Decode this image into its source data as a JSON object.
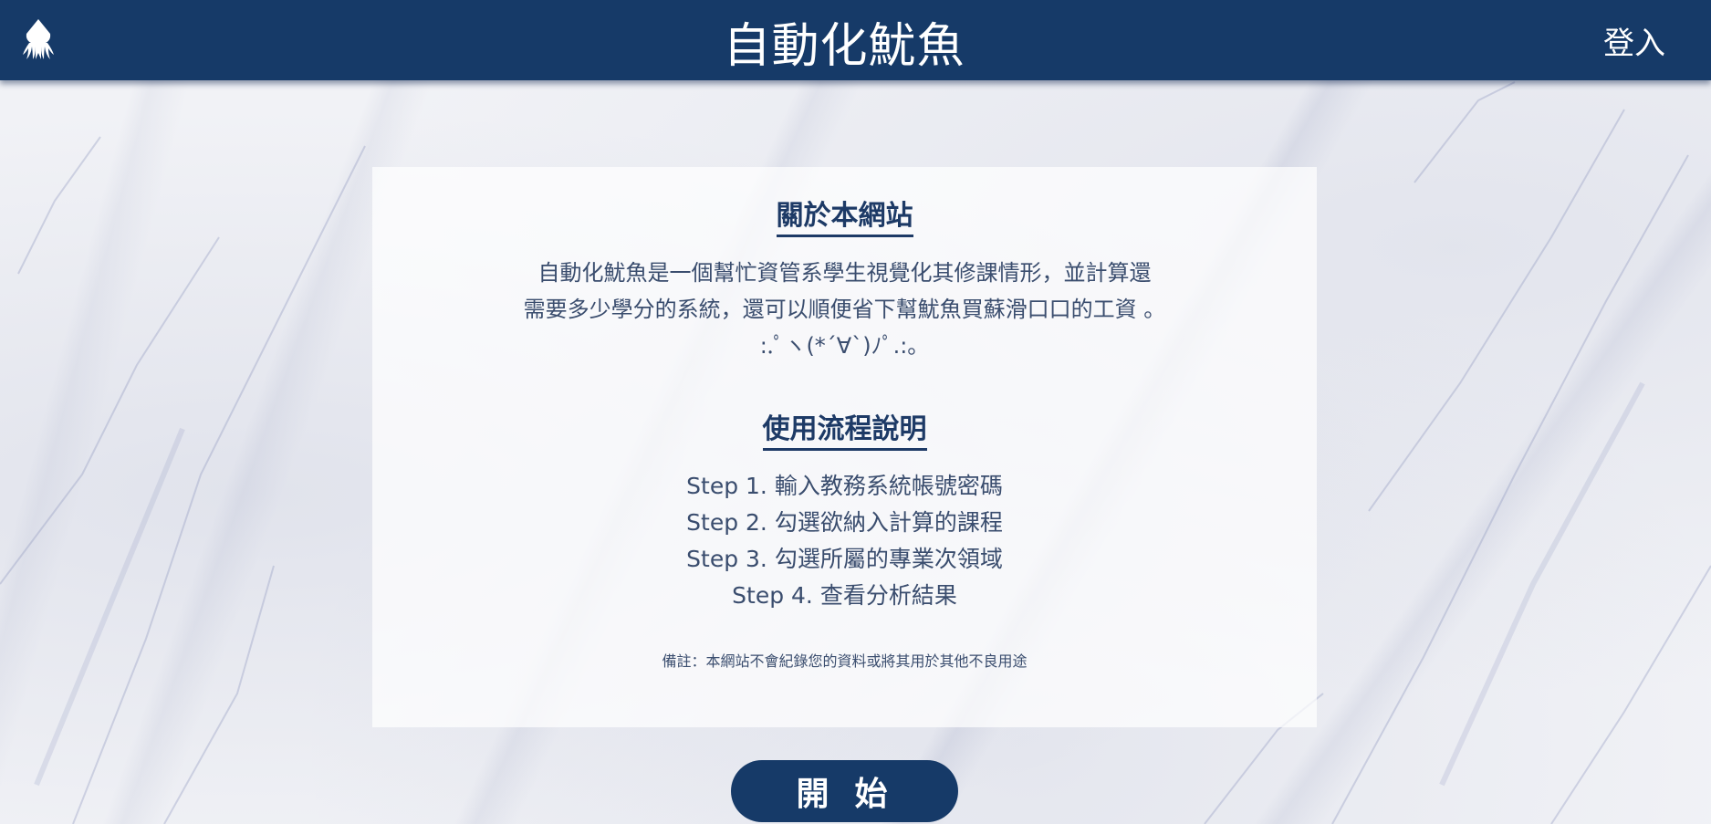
{
  "header": {
    "logo_icon": "squid-icon",
    "title": "自動化魷魚",
    "login_label": "登入",
    "background_color": "#163a68"
  },
  "about": {
    "title": "關於本網站",
    "lines": [
      "自動化魷魚是一個幫忙資管系學生視覺化其修課情形，並計算還",
      "需要多少學分的系統，還可以順便省下幫魷魚買蘇滑口口的工資 。",
      ":.ﾟヽ(*´∀`)ﾉﾟ.:。"
    ]
  },
  "flow": {
    "title": "使用流程說明",
    "steps": [
      "Step 1. 輸入教務系統帳號密碼",
      "Step 2. 勾選欲納入計算的課程",
      "Step 3. 勾選所屬的專業次領域",
      "Step 4. 查看分析結果"
    ]
  },
  "note": "備註：本網站不會紀錄您的資料或將其用於其他不良用途",
  "start_button": {
    "label": "開始"
  }
}
